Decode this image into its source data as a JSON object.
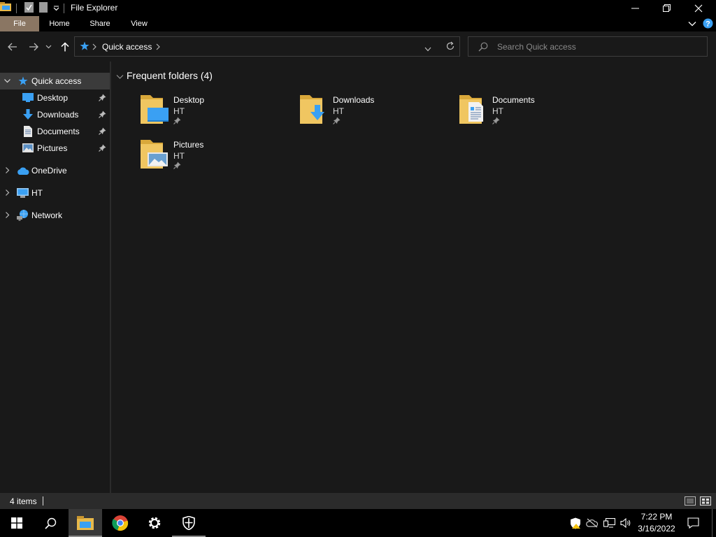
{
  "window": {
    "title": "File Explorer"
  },
  "ribbon": {
    "tabs": [
      {
        "label": "File",
        "active": true
      },
      {
        "label": "Home"
      },
      {
        "label": "Share"
      },
      {
        "label": "View"
      }
    ]
  },
  "address": {
    "location": "Quick access",
    "search_placeholder": "Search Quick access"
  },
  "nav": {
    "quick_access": "Quick access",
    "pinned": [
      {
        "label": "Desktop",
        "icon": "desktop-icon"
      },
      {
        "label": "Downloads",
        "icon": "download-arrow-icon"
      },
      {
        "label": "Documents",
        "icon": "document-icon"
      },
      {
        "label": "Pictures",
        "icon": "picture-icon"
      }
    ],
    "onedrive": "OneDrive",
    "pc": "HT",
    "network": "Network"
  },
  "content": {
    "group_title": "Frequent folders (4)",
    "folders": [
      {
        "name": "Desktop",
        "location": "HT"
      },
      {
        "name": "Downloads",
        "location": "HT"
      },
      {
        "name": "Documents",
        "location": "HT"
      },
      {
        "name": "Pictures",
        "location": "HT"
      }
    ]
  },
  "status": {
    "item_count": "4 items"
  },
  "taskbar": {
    "time": "7:22 PM",
    "date": "3/16/2022"
  },
  "colors": {
    "accent_file_tab": "#8a7663",
    "folder_yellow": "#f0c661",
    "icon_blue": "#3aa0f3"
  }
}
